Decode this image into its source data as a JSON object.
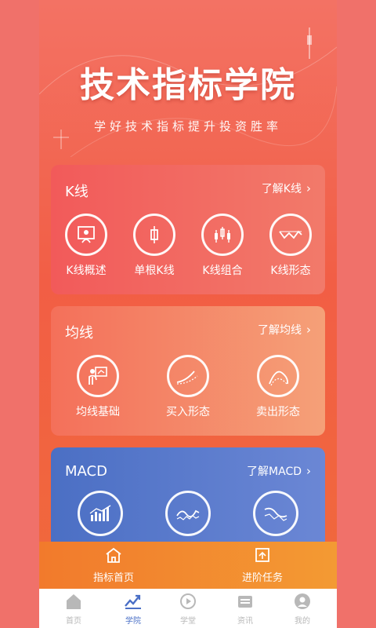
{
  "hero": {
    "title": "技术指标学院",
    "subtitle": "学好技术指标提升投资胜率"
  },
  "cards": {
    "k": {
      "title": "K线",
      "more": "了解K线",
      "items": [
        {
          "label": "K线概述",
          "icon": "teacher-board-icon"
        },
        {
          "label": "单根K线",
          "icon": "single-candle-icon"
        },
        {
          "label": "K线组合",
          "icon": "candle-combo-icon"
        },
        {
          "label": "K线形态",
          "icon": "candle-pattern-icon"
        }
      ]
    },
    "ma": {
      "title": "均线",
      "more": "了解均线",
      "items": [
        {
          "label": "均线基础",
          "icon": "presenter-icon"
        },
        {
          "label": "买入形态",
          "icon": "buy-pattern-icon"
        },
        {
          "label": "卖出形态",
          "icon": "sell-pattern-icon"
        }
      ]
    },
    "macd": {
      "title": "MACD",
      "more": "了解MACD",
      "items": [
        {
          "icon": "macd-bar-chart-icon"
        },
        {
          "icon": "macd-wave-icon"
        },
        {
          "icon": "macd-histogram-icon"
        }
      ]
    }
  },
  "bottom_bar": {
    "left": {
      "label": "指标首页",
      "icon": "home-outline-icon"
    },
    "right": {
      "label": "进阶任务",
      "icon": "task-upload-icon"
    }
  },
  "tabs": [
    {
      "label": "首页",
      "icon": "home-icon",
      "active": false
    },
    {
      "label": "学院",
      "icon": "trend-icon",
      "active": true
    },
    {
      "label": "学堂",
      "icon": "play-icon",
      "active": false
    },
    {
      "label": "资讯",
      "icon": "news-icon",
      "active": false
    },
    {
      "label": "我的",
      "icon": "profile-icon",
      "active": false
    }
  ],
  "colors": {
    "active_tab": "#4a6fc6",
    "inactive_tab": "#b8b8b8",
    "k_card": "#f25a5a",
    "ma_card": "#f4705a",
    "macd_card": "#4b6fc4",
    "bottom_bar": "#f27a2c"
  }
}
